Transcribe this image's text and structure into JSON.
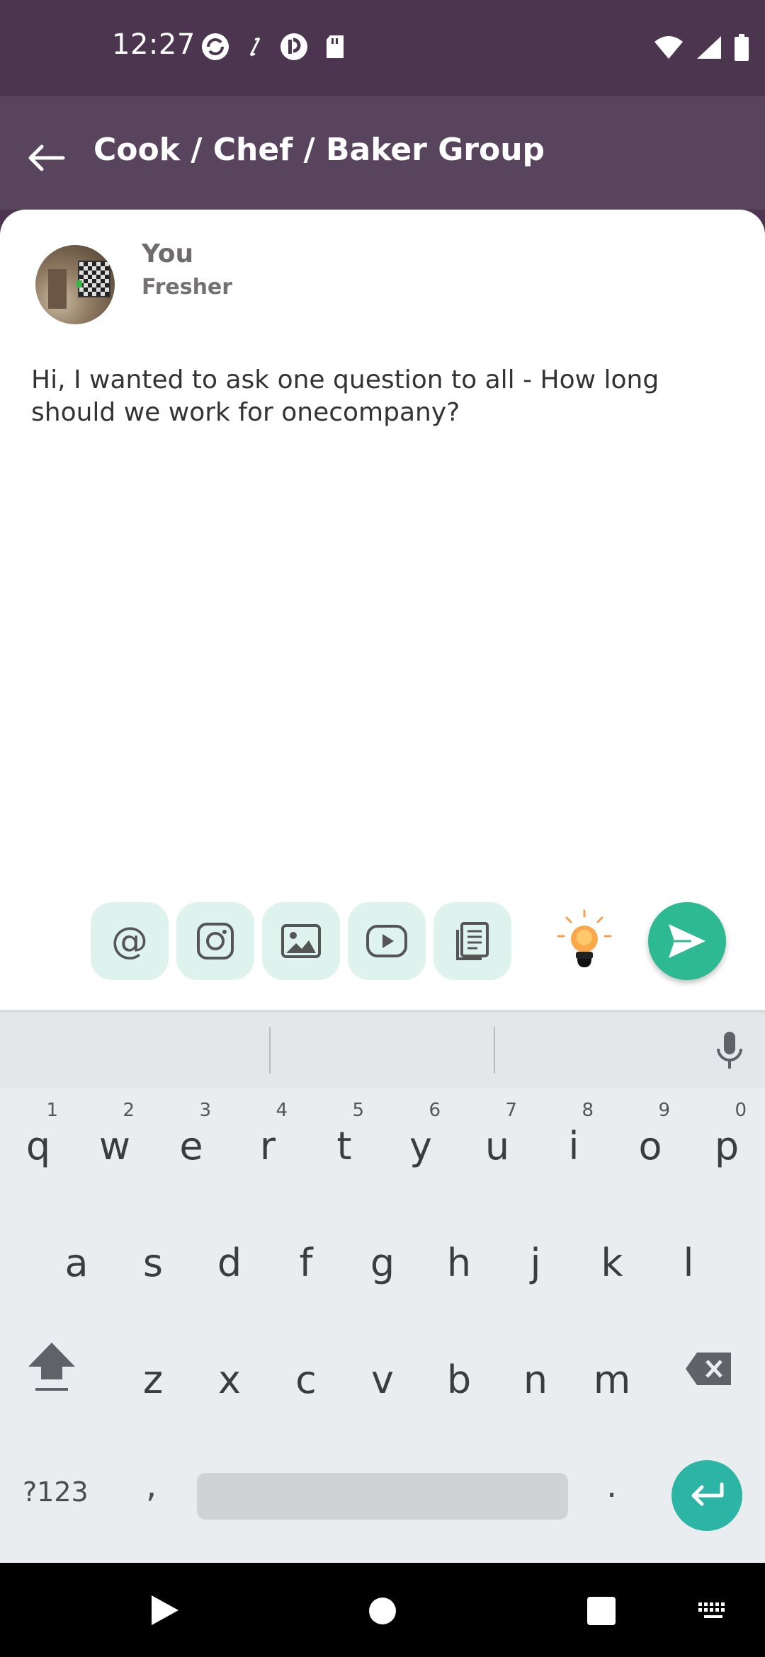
{
  "status_bar": {
    "time": "12:27",
    "left_icons": [
      "sync-icon",
      "data-transfer-icon",
      "app-icon",
      "sd-card-icon"
    ],
    "right_icons": [
      "wifi-icon",
      "signal-icon",
      "battery-icon"
    ]
  },
  "app_bar": {
    "back_icon": "back-arrow-icon",
    "title": "Cook / Chef / Baker Group"
  },
  "post": {
    "author_name": "You",
    "author_role": "Fresher",
    "text": "Hi, I wanted to ask one question to all - How long should we work for onecompany?"
  },
  "toolbar": {
    "tools": [
      "mention",
      "instagram",
      "image",
      "video",
      "document"
    ],
    "mention_glyph": "@",
    "bulb_icon": "idea-bulb-icon",
    "send_icon": "send-icon",
    "accent": "#2db992",
    "tool_bg": "#dff3ee"
  },
  "keyboard": {
    "row1": [
      {
        "ch": "q",
        "num": "1"
      },
      {
        "ch": "w",
        "num": "2"
      },
      {
        "ch": "e",
        "num": "3"
      },
      {
        "ch": "r",
        "num": "4"
      },
      {
        "ch": "t",
        "num": "5"
      },
      {
        "ch": "y",
        "num": "6"
      },
      {
        "ch": "u",
        "num": "7"
      },
      {
        "ch": "i",
        "num": "8"
      },
      {
        "ch": "o",
        "num": "9"
      },
      {
        "ch": "p",
        "num": "0"
      }
    ],
    "row2": [
      "a",
      "s",
      "d",
      "f",
      "g",
      "h",
      "j",
      "k",
      "l"
    ],
    "row3": [
      "z",
      "x",
      "c",
      "v",
      "b",
      "n",
      "m"
    ],
    "symbols_label": "?123",
    "comma": ",",
    "period": ".",
    "enter_color": "#2cb5a5"
  },
  "nav_bar": {
    "icons": [
      "back-triangle-icon",
      "home-circle-icon",
      "recents-square-icon",
      "keyboard-icon"
    ]
  }
}
